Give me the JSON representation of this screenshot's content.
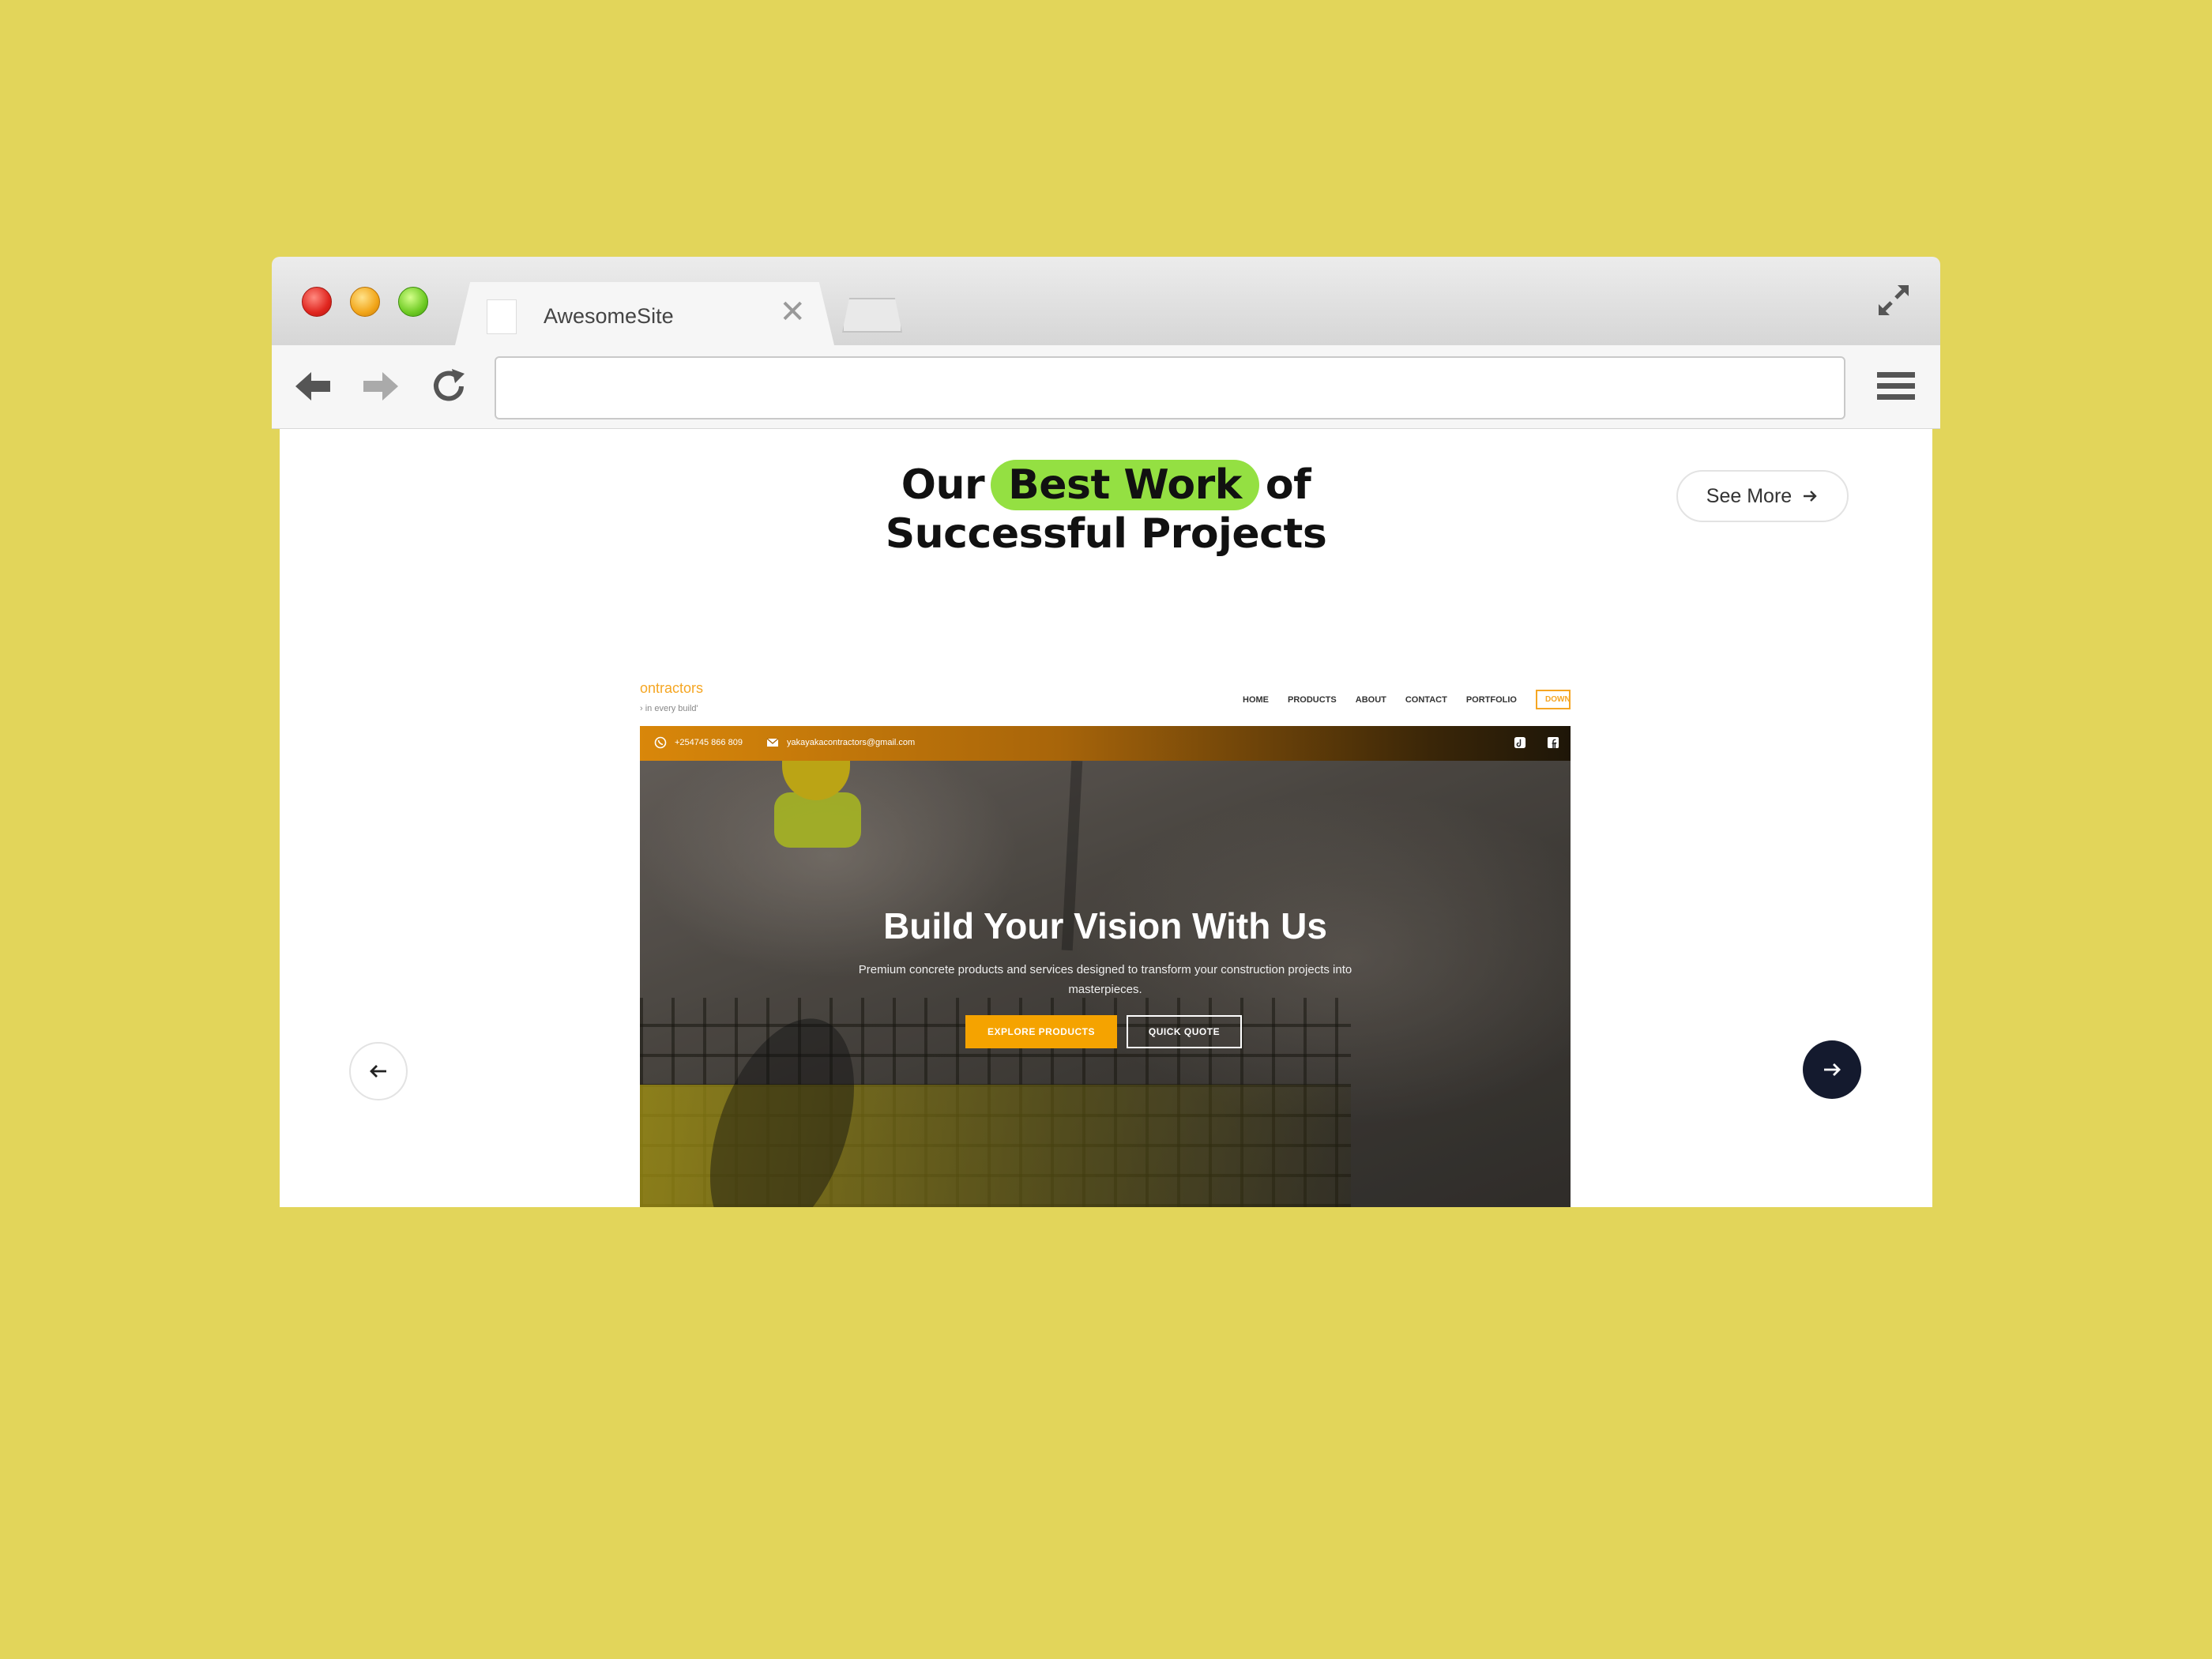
{
  "browser": {
    "tab_title": "AwesomeSite",
    "tab_close": "✕",
    "address_value": ""
  },
  "section": {
    "title_prefix": "Our",
    "title_highlight": "Best Work",
    "title_suffix": "of",
    "title_line2": "Successful Projects",
    "see_more_label": "See More",
    "highlight_color": "#94e042"
  },
  "preview": {
    "logo_text": "ontractors",
    "tagline": "› in every build'",
    "nav": [
      "HOME",
      "PRODUCTS",
      "ABOUT",
      "CONTACT",
      "PORTFOLIO"
    ],
    "nav_cta": "DOWNLOAD",
    "phone": "+254745 866 809",
    "email": "yakayakacontractors@gmail.com",
    "hero_title": "Build Your Vision With Us",
    "hero_subtitle": "Premium concrete products and services designed to transform your construction projects into masterpieces.",
    "primary_button": "EXPLORE PRODUCTS",
    "secondary_button": "QUICK QUOTE",
    "accent_color": "#f5a300"
  },
  "colors": {
    "background": "#e2d55a",
    "next_button": "#141a2e"
  }
}
